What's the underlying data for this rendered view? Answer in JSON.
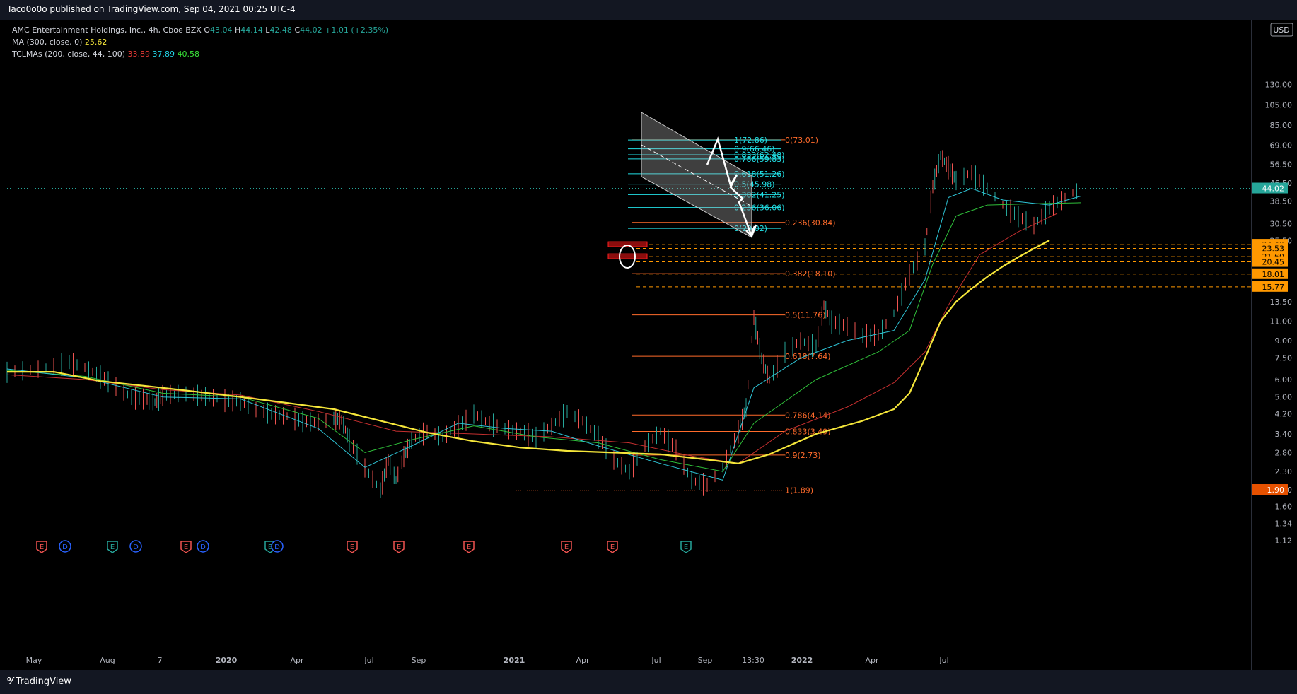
{
  "header": {
    "published": "Taco0o0o published on TradingView.com, Sep 04, 2021 00:25 UTC-4"
  },
  "legend": {
    "symbol": "AMC Entertainment Holdings, Inc., 4h, Cboe BZX",
    "ohlc": [
      {
        "key": "O",
        "value": "43.04"
      },
      {
        "key": "H",
        "value": "44.14"
      },
      {
        "key": "L",
        "value": "42.48"
      },
      {
        "key": "C",
        "value": "44.02"
      }
    ],
    "change": "+1.01 (+2.35%)",
    "ma_label": "MA (300, close, 0)",
    "ma_value": "25.62",
    "tclmas_label": "TCLMAs (200, close, 44, 100)",
    "tclmas_values": [
      "33.89",
      "37.89",
      "40.58"
    ]
  },
  "footer": {
    "brand": "TradingView"
  },
  "colors": {
    "up": "#26a69a",
    "down": "#ef5350",
    "ma300": "#f5e63a",
    "tcl_red": "#c42f2f",
    "tcl_cyan": "#2ec4d6",
    "tcl_green": "#2fbf3a",
    "fib_cyan": "#22e0e6",
    "fib_orange": "#ff6b2b",
    "price_tag": "#e0e0e0"
  },
  "chart_data": {
    "type": "line",
    "title": "AMC Entertainment Holdings, Inc., 4h, Cboe BZX",
    "scale": "log",
    "currency": "USD",
    "last_price": "44.02",
    "y_ticks": [
      "130.00",
      "105.00",
      "85.00",
      "69.00",
      "56.50",
      "46.50",
      "38.50",
      "30.50",
      "25.50",
      "13.50",
      "11.00",
      "9.00",
      "7.50",
      "6.00",
      "5.00",
      "4.20",
      "3.40",
      "2.80",
      "2.30",
      "1.90",
      "1.60",
      "1.34",
      "1.12"
    ],
    "x_ticks": [
      {
        "label": "May",
        "bold": false
      },
      {
        "label": "Aug",
        "bold": false
      },
      {
        "label": "7",
        "bold": false
      },
      {
        "label": "2020",
        "bold": true
      },
      {
        "label": "Apr",
        "bold": false
      },
      {
        "label": "Jul",
        "bold": false
      },
      {
        "label": "Sep",
        "bold": false
      },
      {
        "label": "2021",
        "bold": true
      },
      {
        "label": "Apr",
        "bold": false
      },
      {
        "label": "Jul",
        "bold": false
      },
      {
        "label": "Sep",
        "bold": false
      },
      {
        "label": "13:30",
        "bold": false
      },
      {
        "label": "2022",
        "bold": true
      },
      {
        "label": "Apr",
        "bold": false
      },
      {
        "label": "Jul",
        "bold": false
      }
    ],
    "price_path": [
      [
        0,
        6.5
      ],
      [
        4,
        6.7
      ],
      [
        8,
        7.2
      ],
      [
        10,
        6.8
      ],
      [
        12,
        6.2
      ],
      [
        14,
        5.6
      ],
      [
        16,
        5.0
      ],
      [
        18,
        4.9
      ],
      [
        19,
        4.75
      ],
      [
        20,
        5.1
      ],
      [
        22,
        5.2
      ],
      [
        24,
        5.15
      ],
      [
        26,
        5.0
      ],
      [
        28,
        4.85
      ],
      [
        30,
        4.8
      ],
      [
        32,
        4.4
      ],
      [
        34,
        4.2
      ],
      [
        36,
        4.1
      ],
      [
        38,
        3.9
      ],
      [
        40,
        3.85
      ],
      [
        42,
        4.0
      ],
      [
        43,
        3.95
      ],
      [
        44,
        3.2
      ],
      [
        46,
        2.4
      ],
      [
        48,
        1.9
      ],
      [
        49,
        2.6
      ],
      [
        50,
        2.1
      ],
      [
        51,
        2.7
      ],
      [
        52,
        3.2
      ],
      [
        54,
        3.5
      ],
      [
        56,
        3.3
      ],
      [
        58,
        3.7
      ],
      [
        60,
        4.2
      ],
      [
        62,
        3.8
      ],
      [
        64,
        3.6
      ],
      [
        66,
        3.5
      ],
      [
        68,
        3.3
      ],
      [
        70,
        3.7
      ],
      [
        72,
        4.3
      ],
      [
        74,
        3.9
      ],
      [
        76,
        3.3
      ],
      [
        78,
        2.6
      ],
      [
        80,
        2.3
      ],
      [
        82,
        3.0
      ],
      [
        84,
        3.5
      ],
      [
        86,
        2.9
      ],
      [
        88,
        2.1
      ],
      [
        90,
        2.0
      ],
      [
        92,
        2.4
      ],
      [
        94,
        3.5
      ],
      [
        95,
        4.5
      ],
      [
        96,
        11.5
      ],
      [
        97,
        7.5
      ],
      [
        98,
        6.0
      ],
      [
        100,
        8.0
      ],
      [
        102,
        9.0
      ],
      [
        104,
        8.5
      ],
      [
        105,
        13.0
      ],
      [
        106,
        11.0
      ],
      [
        108,
        10.5
      ],
      [
        110,
        9.5
      ],
      [
        112,
        9.6
      ],
      [
        114,
        12.0
      ],
      [
        116,
        18.0
      ],
      [
        118,
        24.0
      ],
      [
        119,
        45.0
      ],
      [
        120,
        62.0
      ],
      [
        121,
        55.0
      ],
      [
        122,
        48.0
      ],
      [
        124,
        52.0
      ],
      [
        126,
        44.0
      ],
      [
        128,
        37.0
      ],
      [
        130,
        33.0
      ],
      [
        132,
        30.0
      ],
      [
        134,
        36.0
      ],
      [
        136,
        40.0
      ],
      [
        138,
        44.02
      ]
    ],
    "ma300_path": [
      [
        0,
        6.5
      ],
      [
        6,
        6.5
      ],
      [
        12,
        5.9
      ],
      [
        18,
        5.6
      ],
      [
        24,
        5.3
      ],
      [
        30,
        5.0
      ],
      [
        36,
        4.7
      ],
      [
        42,
        4.4
      ],
      [
        48,
        3.9
      ],
      [
        54,
        3.45
      ],
      [
        60,
        3.15
      ],
      [
        66,
        2.95
      ],
      [
        72,
        2.85
      ],
      [
        78,
        2.8
      ],
      [
        84,
        2.75
      ],
      [
        90,
        2.6
      ],
      [
        94,
        2.5
      ],
      [
        98,
        2.75
      ],
      [
        104,
        3.4
      ],
      [
        110,
        3.9
      ],
      [
        114,
        4.4
      ],
      [
        116,
        5.2
      ],
      [
        118,
        7.5
      ],
      [
        120,
        11.0
      ],
      [
        122,
        13.5
      ],
      [
        124,
        15.5
      ],
      [
        126,
        17.5
      ],
      [
        128,
        19.5
      ],
      [
        130,
        21.5
      ],
      [
        132,
        23.5
      ],
      [
        134,
        25.62
      ]
    ],
    "ma_red_path": [
      [
        0,
        6.3
      ],
      [
        10,
        6.0
      ],
      [
        20,
        5.4
      ],
      [
        30,
        5.1
      ],
      [
        40,
        4.3
      ],
      [
        50,
        3.5
      ],
      [
        60,
        3.4
      ],
      [
        70,
        3.3
      ],
      [
        80,
        3.1
      ],
      [
        88,
        2.7
      ],
      [
        94,
        2.5
      ],
      [
        100,
        3.5
      ],
      [
        108,
        4.5
      ],
      [
        114,
        5.8
      ],
      [
        118,
        8.0
      ],
      [
        121,
        13.0
      ],
      [
        125,
        22.0
      ],
      [
        130,
        28.0
      ],
      [
        135,
        33.89
      ]
    ],
    "ma_green_path": [
      [
        0,
        6.6
      ],
      [
        10,
        6.2
      ],
      [
        20,
        5.2
      ],
      [
        30,
        5.0
      ],
      [
        40,
        4.0
      ],
      [
        46,
        2.8
      ],
      [
        52,
        3.2
      ],
      [
        60,
        3.7
      ],
      [
        68,
        3.3
      ],
      [
        76,
        3.1
      ],
      [
        84,
        2.6
      ],
      [
        92,
        2.3
      ],
      [
        96,
        3.8
      ],
      [
        104,
        6.0
      ],
      [
        112,
        8.0
      ],
      [
        116,
        10.0
      ],
      [
        119,
        20.0
      ],
      [
        122,
        33.0
      ],
      [
        126,
        37.0
      ],
      [
        132,
        37.5
      ],
      [
        138,
        37.89
      ]
    ],
    "ma_cyan_path": [
      [
        0,
        6.7
      ],
      [
        10,
        6.1
      ],
      [
        20,
        5.0
      ],
      [
        30,
        4.9
      ],
      [
        40,
        3.6
      ],
      [
        46,
        2.4
      ],
      [
        52,
        3.0
      ],
      [
        58,
        3.8
      ],
      [
        64,
        3.6
      ],
      [
        70,
        3.5
      ],
      [
        76,
        3.0
      ],
      [
        84,
        2.5
      ],
      [
        92,
        2.1
      ],
      [
        96,
        5.5
      ],
      [
        102,
        7.5
      ],
      [
        108,
        9.0
      ],
      [
        114,
        10.0
      ],
      [
        118,
        17.0
      ],
      [
        121,
        40.0
      ],
      [
        124,
        44.0
      ],
      [
        128,
        39.0
      ],
      [
        134,
        37.0
      ],
      [
        138,
        40.58
      ]
    ],
    "fib_cyan": [
      {
        "label": "1(72.86)",
        "level": 72.86
      },
      {
        "label": "0.9(66.46)",
        "level": 66.46
      },
      {
        "label": "0.833(62.48)",
        "level": 62.48
      },
      {
        "label": "0.786(59.83)",
        "level": 59.83
      },
      {
        "label": "0.618(51.26)",
        "level": 51.26
      },
      {
        "label": "0.5(45.98)",
        "level": 45.98
      },
      {
        "label": "0.382(41.25)",
        "level": 41.25
      },
      {
        "label": "0.236(36.06)",
        "level": 36.06
      },
      {
        "label": "0(29.02)",
        "level": 29.02
      }
    ],
    "fib_orange": [
      {
        "label": "0(73.01)",
        "level": 73.01
      },
      {
        "label": "0.236(30.84)",
        "level": 30.84
      },
      {
        "label": "0.382(18.10)",
        "level": 18.1
      },
      {
        "label": "0.5(11.76)",
        "level": 11.76
      },
      {
        "label": "0.618(7.64)",
        "level": 7.64
      },
      {
        "label": "0.786(4.14)",
        "level": 4.14
      },
      {
        "label": "0.833(3.49)",
        "level": 3.49
      },
      {
        "label": "0.9(2.73)",
        "level": 2.73
      },
      {
        "label": "1(1.89)",
        "level": 1.89
      }
    ],
    "dashed_levels": [
      "24.49",
      "23.53",
      "21.60",
      "20.45",
      "18.01",
      "15.77"
    ],
    "low_tag": "1.90",
    "events": [
      "E",
      "D",
      "E",
      "D",
      "E",
      "D",
      "E",
      "D",
      "E",
      "E",
      "E",
      "E",
      "E",
      "E"
    ],
    "events_colors": [
      "#ef5350",
      "#2962ff",
      "#26a69a",
      "#2962ff",
      "#ef5350",
      "#2962ff",
      "#26a69a",
      "#2962ff",
      "#ef5350",
      "#ef5350",
      "#ef5350",
      "#ef5350",
      "#ef5350",
      "#26a69a"
    ]
  }
}
